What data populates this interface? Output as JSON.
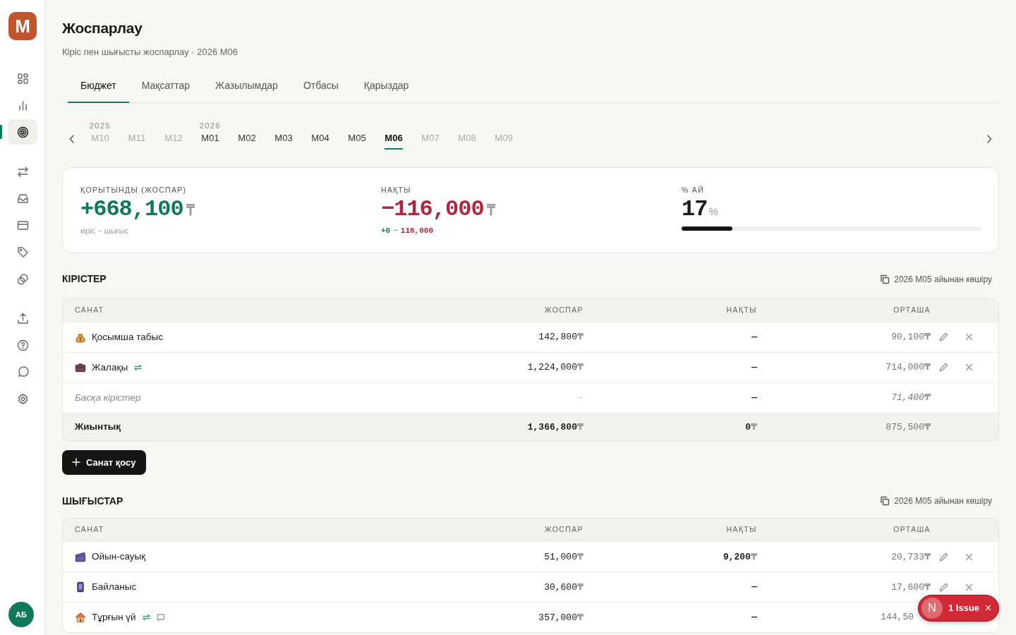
{
  "app": {
    "logo": "M",
    "avatar": "АБ"
  },
  "sidebar": {
    "groups": [
      [
        {
          "kind": "grid",
          "selected": false
        },
        {
          "kind": "chart",
          "selected": false
        },
        {
          "kind": "target",
          "selected": true
        }
      ],
      [
        {
          "kind": "transfer",
          "selected": false
        },
        {
          "kind": "inbox",
          "selected": false
        },
        {
          "kind": "card",
          "selected": false
        },
        {
          "kind": "tag",
          "selected": false
        },
        {
          "kind": "coins",
          "selected": false
        }
      ],
      [
        {
          "kind": "upload",
          "selected": false
        },
        {
          "kind": "help",
          "selected": false
        },
        {
          "kind": "chat",
          "selected": false
        },
        {
          "kind": "settings",
          "selected": false
        }
      ]
    ]
  },
  "page": {
    "title": "Жоспарлау",
    "subtitle": "Кіріс пен шығысты жоспарлау · 2026 М06"
  },
  "tabs": [
    {
      "label": "Бюджет",
      "selected": true
    },
    {
      "label": "Мақсаттар",
      "selected": false
    },
    {
      "label": "Жазылымдар",
      "selected": false
    },
    {
      "label": "Отбасы",
      "selected": false
    },
    {
      "label": "Қарыздар",
      "selected": false
    }
  ],
  "months": [
    {
      "year": "2025",
      "label": "М10",
      "muted": true,
      "selected": false
    },
    {
      "label": "М11",
      "muted": true,
      "selected": false
    },
    {
      "label": "М12",
      "muted": true,
      "selected": false
    },
    {
      "year": "2026",
      "label": "М01",
      "muted": false,
      "selected": false
    },
    {
      "label": "М02",
      "muted": false,
      "selected": false
    },
    {
      "label": "М03",
      "muted": false,
      "selected": false
    },
    {
      "label": "М04",
      "muted": false,
      "selected": false
    },
    {
      "label": "М05",
      "muted": false,
      "selected": false
    },
    {
      "label": "М06",
      "muted": false,
      "selected": true
    },
    {
      "label": "М07",
      "muted": true,
      "selected": false
    },
    {
      "label": "М08",
      "muted": true,
      "selected": false
    },
    {
      "label": "М09",
      "muted": true,
      "selected": false
    }
  ],
  "summary": [
    {
      "kind": "amount",
      "label": "ҚОРЫТЫНДЫ (ЖОСПАР)",
      "value": "+668,100",
      "unit": "₸",
      "color": "#0f7a5a",
      "note": "кіріс − шығыс"
    },
    {
      "kind": "amount",
      "label": "НАҚТЫ",
      "value": "−116,000",
      "unit": "₸",
      "color": "#b0263f",
      "parts": [
        {
          "text": "+0",
          "color": "#0f7a5a"
        },
        {
          "text": "−",
          "color": "#999999"
        },
        {
          "text": "116,000",
          "color": "#b0263f"
        }
      ]
    },
    {
      "kind": "progress",
      "label": "% АЙ",
      "value": "17",
      "unit": "%",
      "level": 0.17
    }
  ],
  "sections": [
    {
      "title": "КІРІСТЕР",
      "copy_action": "2026 М05 айынан көшіру",
      "columns": [
        "САНАТ",
        "ЖОСПАР",
        "НАҚТЫ",
        "ОРТАША"
      ],
      "rows": [
        {
          "kind": "category",
          "name": "Қосымша табыс",
          "recurring": false,
          "note": false,
          "actions": true,
          "plan": [
            "142,800",
            "₸"
          ],
          "actual": [
            "—"
          ],
          "average": [
            "90,100",
            "₸"
          ]
        },
        {
          "kind": "category",
          "name": "Жалақы",
          "recurring": true,
          "note": false,
          "actions": true,
          "plan": [
            "1,224,000",
            "₸"
          ],
          "actual": [
            "—"
          ],
          "average": [
            "714,000",
            "₸"
          ]
        },
        {
          "kind": "other",
          "name": "Басқа кірістер",
          "plan": [
            "–"
          ],
          "actual": [
            "—"
          ],
          "average": [
            "71,400",
            "₸"
          ]
        },
        {
          "kind": "total",
          "name": "Жиынтық",
          "plan": [
            "1,366,800",
            "₸"
          ],
          "actual": [
            "0",
            "₸"
          ],
          "average": [
            "875,500",
            "₸"
          ]
        }
      ],
      "add_button": "Санат қосу"
    },
    {
      "title": "ШЫҒЫСТАР",
      "copy_action": "2026 М05 айынан көшіру",
      "columns": [
        "САНАТ",
        "ЖОСПАР",
        "НАҚТЫ",
        "ОРТАША"
      ],
      "rows": [
        {
          "kind": "category",
          "name": "Ойын-сауық",
          "recurring": false,
          "note": false,
          "actions": true,
          "plan": [
            "51,000",
            "₸"
          ],
          "actual": [
            "9,200",
            "₸"
          ],
          "average": [
            "20,733",
            "₸"
          ]
        },
        {
          "kind": "category",
          "name": "Байланыс",
          "recurring": false,
          "note": false,
          "actions": true,
          "plan": [
            "30,600",
            "₸"
          ],
          "actual": [
            "—"
          ],
          "average": [
            "17,600",
            "₸"
          ]
        },
        {
          "kind": "category",
          "name": "Тұрғын үй",
          "recurring": true,
          "note": true,
          "actions": false,
          "plan": [
            "357,000",
            "₸"
          ],
          "actual": [
            "—"
          ],
          "average": [
            "144,50"
          ]
        }
      ]
    }
  ],
  "issue_badge": {
    "letter": "N",
    "label": "1 Issue",
    "close": "×"
  }
}
